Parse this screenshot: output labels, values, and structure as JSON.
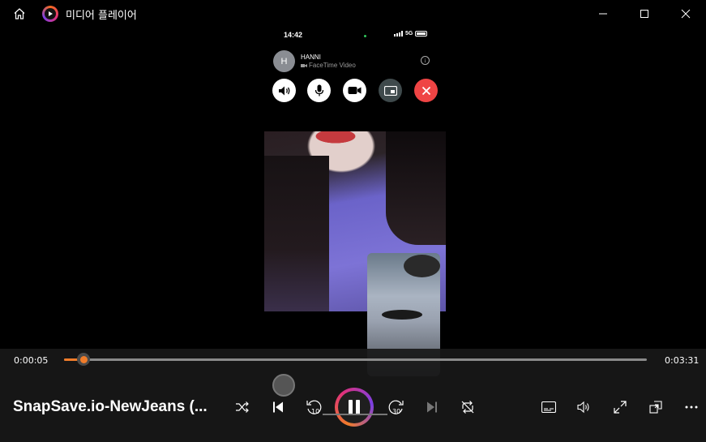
{
  "window": {
    "app_title": "미디어 플레이어",
    "accent": "#f07c2a"
  },
  "video": {
    "status_time": "14:42",
    "network": "5G",
    "caller_initial": "H",
    "caller_name": "HANNI",
    "call_type": "FaceTime Video",
    "decline_color": "#ef4444"
  },
  "player": {
    "elapsed": "0:00:05",
    "remaining": "0:03:31",
    "progress_fraction": 0.034,
    "media_title": "SnapSave.io-NewJeans (...",
    "skip_back_seconds": "10",
    "skip_forward_seconds": "30"
  },
  "icons": [
    "home-icon",
    "app-logo-icon",
    "minimize-icon",
    "maximize-icon",
    "close-icon",
    "shuffle-icon",
    "previous-icon",
    "skip-back-icon",
    "pause-icon",
    "skip-forward-icon",
    "next-icon",
    "repeat-off-icon",
    "subtitles-icon",
    "volume-icon",
    "fullscreen-icon",
    "mini-player-icon",
    "more-icon"
  ]
}
